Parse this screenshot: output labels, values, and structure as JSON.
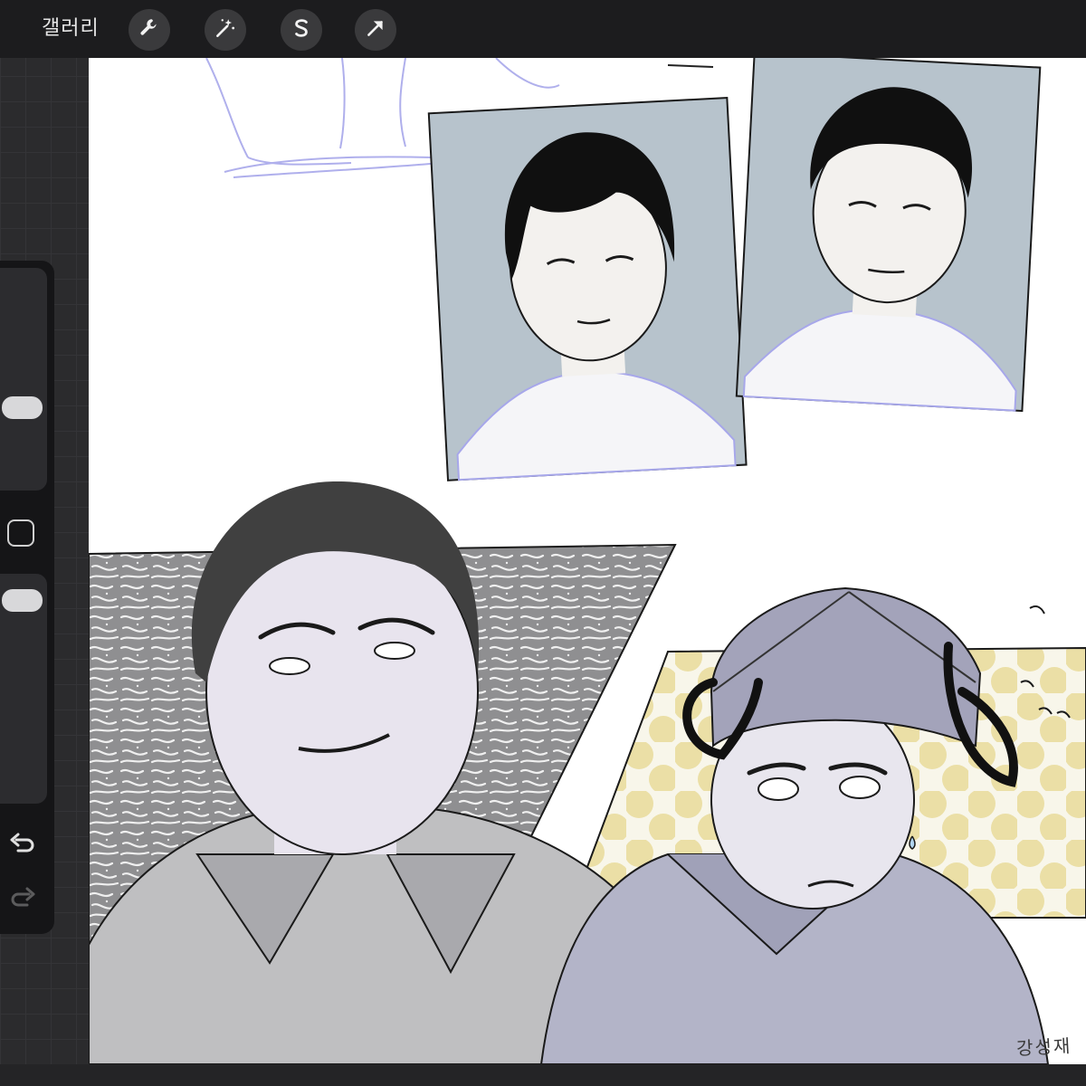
{
  "topbar": {
    "gallery_label": "갤러리",
    "tools": [
      {
        "icon": "wrench-icon"
      },
      {
        "icon": "magic-wand-icon"
      },
      {
        "icon": "selection-s-icon"
      },
      {
        "icon": "arrow-cursor-icon"
      }
    ]
  },
  "sidebar": {
    "brush_size_level": 0.65,
    "opacity_level": 0.06
  },
  "canvas": {
    "signature_text": "강성재"
  },
  "colors": {
    "topbar": "#1c1c1e",
    "sidebar": "#151517",
    "tool_button": "#3a3a3c",
    "canvas": "#ffffff",
    "sketch_blue": "#9b9be6",
    "photo_bg": "#b7c3cc",
    "dot_yellow": "#ebdfa6"
  }
}
